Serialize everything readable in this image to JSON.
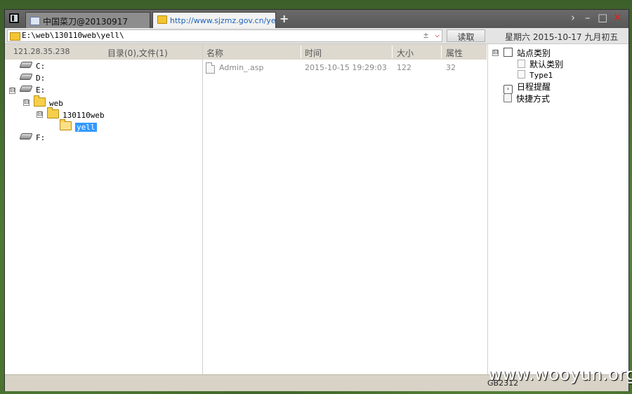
{
  "tabs": [
    {
      "label": "中国菜刀@20130917",
      "active": false
    },
    {
      "label": "http://www.sjzmz.gov.cn/yell...",
      "active": true
    }
  ],
  "new_tab_symbol": "+",
  "window_controls": {
    "next": "›",
    "minimize": "–",
    "maximize": "□",
    "close": "✕"
  },
  "address": {
    "path": "E:\\web\\130110web\\yell\\",
    "pm_symbol": "±",
    "dropdown_symbol": "⌵",
    "read_label": "读取"
  },
  "date": "星期六 2015-10-17 九月初五",
  "left_header": {
    "ip": "121.28.35.238",
    "counts": "目录(0),文件(1)"
  },
  "tree": {
    "c": "C:",
    "d": "D:",
    "e": "E:",
    "e_expander": "⊟",
    "web": "web",
    "web_expander": "⊟",
    "web130110": "130110web",
    "web130110_expander": "⊟",
    "yell": "yell",
    "f": "F:"
  },
  "columns": {
    "name": "名称",
    "time": "时间",
    "size": "大小",
    "attr": "属性"
  },
  "files": [
    {
      "name": "Admin_.asp",
      "time": "2015-10-15 19:29:03",
      "size": "122",
      "attr": "32"
    }
  ],
  "right_tree": {
    "root_expander": "⊟",
    "site_category": "站点类别",
    "default_category": "默认类别",
    "type1": "Type1",
    "schedule": "日程提醒",
    "shortcuts": "快捷方式"
  },
  "status": {
    "encoding": "GB2312"
  },
  "watermark": "www.wooyun.org",
  "colors": {
    "tab_link": "#1e62b8",
    "selection": "#3399ff",
    "close": "#e02020"
  }
}
